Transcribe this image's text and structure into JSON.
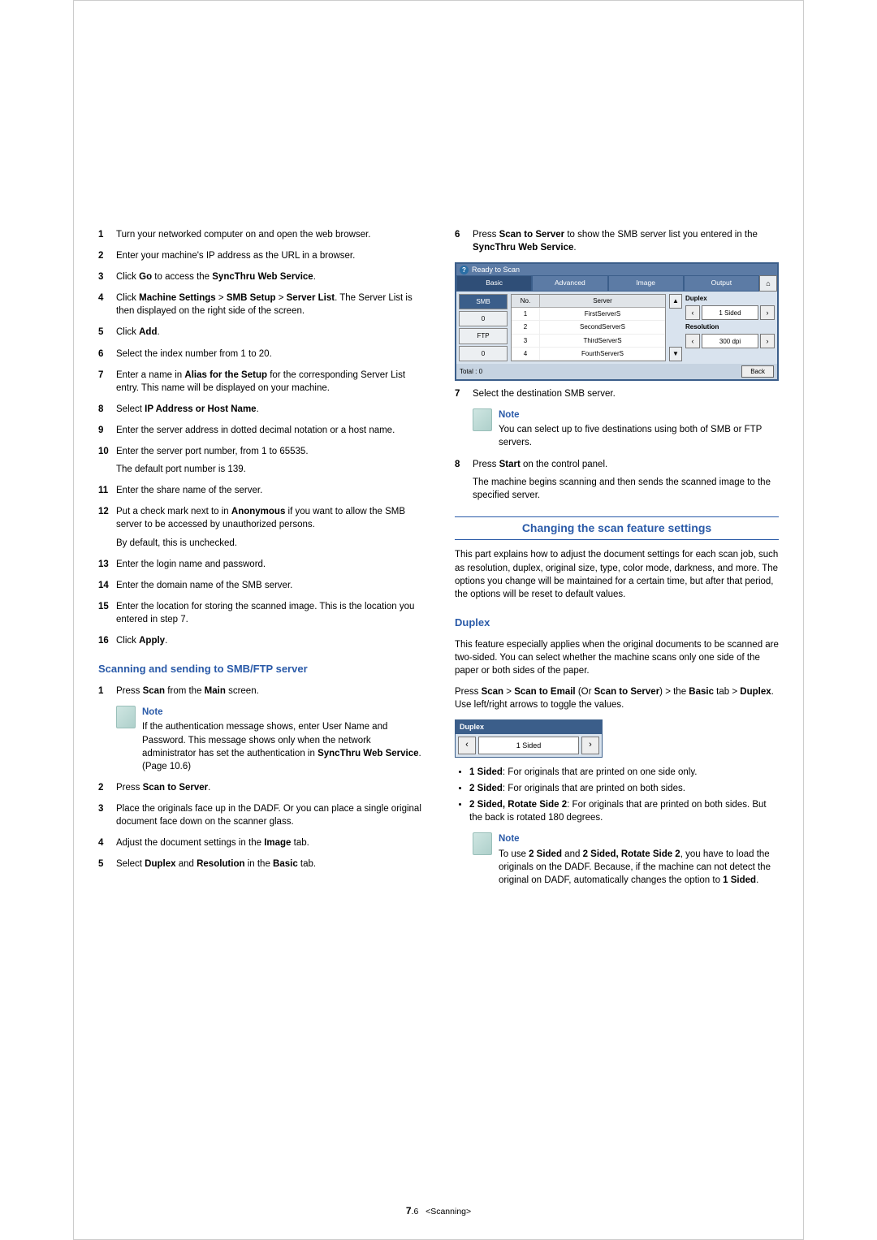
{
  "left_steps_a": [
    {
      "n": "1",
      "html": "Turn your networked computer on and open the web browser."
    },
    {
      "n": "2",
      "html": "Enter your machine's IP address as the URL in a browser."
    },
    {
      "n": "3",
      "html": "Click <b>Go</b> to access the <b>SyncThru Web Service</b>."
    },
    {
      "n": "4",
      "html": "Click <b>Machine Settings</b> > <b>SMB Setup</b> > <b>Server List</b>. The Server List is then displayed on the right side of the screen."
    },
    {
      "n": "5",
      "html": "Click <b>Add</b>."
    },
    {
      "n": "6",
      "html": "Select the index number from 1 to 20."
    },
    {
      "n": "7",
      "html": "Enter a name in <b>Alias for the Setup</b> for the corresponding Server List entry. This name will be displayed on your machine."
    },
    {
      "n": "8",
      "html": "Select <b>IP Address or Host Name</b>."
    },
    {
      "n": "9",
      "html": "Enter the server address in dotted decimal notation or a host name."
    },
    {
      "n": "10",
      "html": "Enter the server port number, from 1 to 65535.",
      "p2": "The default port number is 139."
    },
    {
      "n": "11",
      "html": "Enter the share name of the server."
    },
    {
      "n": "12",
      "html": "Put a check mark next to in <b>Anonymous</b> if you want to allow the SMB server to be accessed by unauthorized persons.",
      "p2": "By default, this is unchecked."
    },
    {
      "n": "13",
      "html": "Enter the login name and password."
    },
    {
      "n": "14",
      "html": "Enter the domain name of the SMB server."
    },
    {
      "n": "15",
      "html": "Enter the location for storing the scanned image. This is the location you entered in step 7."
    },
    {
      "n": "16",
      "html": "Click <b>Apply</b>."
    }
  ],
  "left_subheading": "Scanning and sending to SMB/FTP server",
  "left_steps_b": [
    {
      "n": "1",
      "html": "Press <b>Scan</b> from the <b>Main</b> screen."
    }
  ],
  "left_note1": {
    "title": "Note",
    "body": "If the authentication message shows, enter User Name and Password. This message shows only when the network administrator has set the authentication in <b>SyncThru Web Service</b>. (Page 10.6)"
  },
  "left_steps_c": [
    {
      "n": "2",
      "html": "Press <b>Scan to Server</b>."
    },
    {
      "n": "3",
      "html": "Place the originals face up in the DADF. Or you can place a single original document face down on the scanner glass."
    },
    {
      "n": "4",
      "html": "Adjust the document settings in the <b>Image</b> tab."
    },
    {
      "n": "5",
      "html": "Select <b>Duplex</b> and <b>Resolution</b> in the <b>Basic</b> tab."
    }
  ],
  "right_steps_a": [
    {
      "n": "6",
      "html": "Press <b>Scan to Server</b> to show the SMB server list you entered in the <b>SyncThru Web Service</b>."
    }
  ],
  "ui": {
    "title": "Ready to Scan",
    "tabs": [
      "Basic",
      "Advanced",
      "Image",
      "Output"
    ],
    "home_icon": "home-icon",
    "left_tabs": [
      "SMB",
      "0",
      "FTP",
      "0"
    ],
    "table_headers": {
      "no": "No.",
      "server": "Server"
    },
    "rows": [
      {
        "no": "1",
        "server": "FirstServerS"
      },
      {
        "no": "2",
        "server": "SecondServerS"
      },
      {
        "no": "3",
        "server": "ThirdServerS"
      },
      {
        "no": "4",
        "server": "FourthServerS"
      }
    ],
    "duplex_label": "Duplex",
    "duplex_value": "1 Sided",
    "resolution_label": "Resolution",
    "resolution_value": "300 dpi",
    "total_label": "Total : 0",
    "back_label": "Back"
  },
  "right_steps_b": [
    {
      "n": "7",
      "html": "Select the destination SMB server."
    }
  ],
  "right_note1": {
    "title": "Note",
    "body": "You can select up to five destinations using both of SMB or FTP servers."
  },
  "right_steps_c": [
    {
      "n": "8",
      "html": "Press <b>Start</b> on the control panel.",
      "p2": "The machine begins scanning and then sends the scanned image to the specified server."
    }
  ],
  "heading_change": "Changing the scan feature settings",
  "change_para": "This part explains how to adjust the document settings for each scan job, such as resolution, duplex, original size, type, color mode, darkness, and more. The options you change will be maintained for a certain time, but after that period, the options will be reset to default values.",
  "duplex_heading": "Duplex",
  "duplex_para1": "This feature especially applies when the original documents to be scanned are two-sided. You can select whether the machine scans only one side of the paper or both sides of the paper.",
  "duplex_para2": "Press <b>Scan</b> > <b>Scan to Email</b> (Or <b>Scan to Server</b>) > the <b>Basic</b> tab > <b>Duplex</b>. Use left/right arrows to toggle the values.",
  "duplex_widget": {
    "title": "Duplex",
    "value": "1 Sided"
  },
  "duplex_bullets": [
    "<b>1 Sided</b>: For originals that are printed on one side only.",
    "<b>2 Sided</b>: For originals that are printed on both sides.",
    "<b>2 Sided, Rotate Side 2</b>: For originals that are printed on both sides. But the back is rotated 180 degrees."
  ],
  "right_note2": {
    "title": "Note",
    "body": "To use <b>2 Sided</b> and <b>2 Sided, Rotate Side 2</b>, you have to load the originals on the DADF. Because, if the machine can not detect the original on DADF, automatically changes the option to <b>1 Sided</b>."
  },
  "footer": {
    "page_num": "7",
    "page_sub": ".6",
    "section": "<Scanning>"
  }
}
